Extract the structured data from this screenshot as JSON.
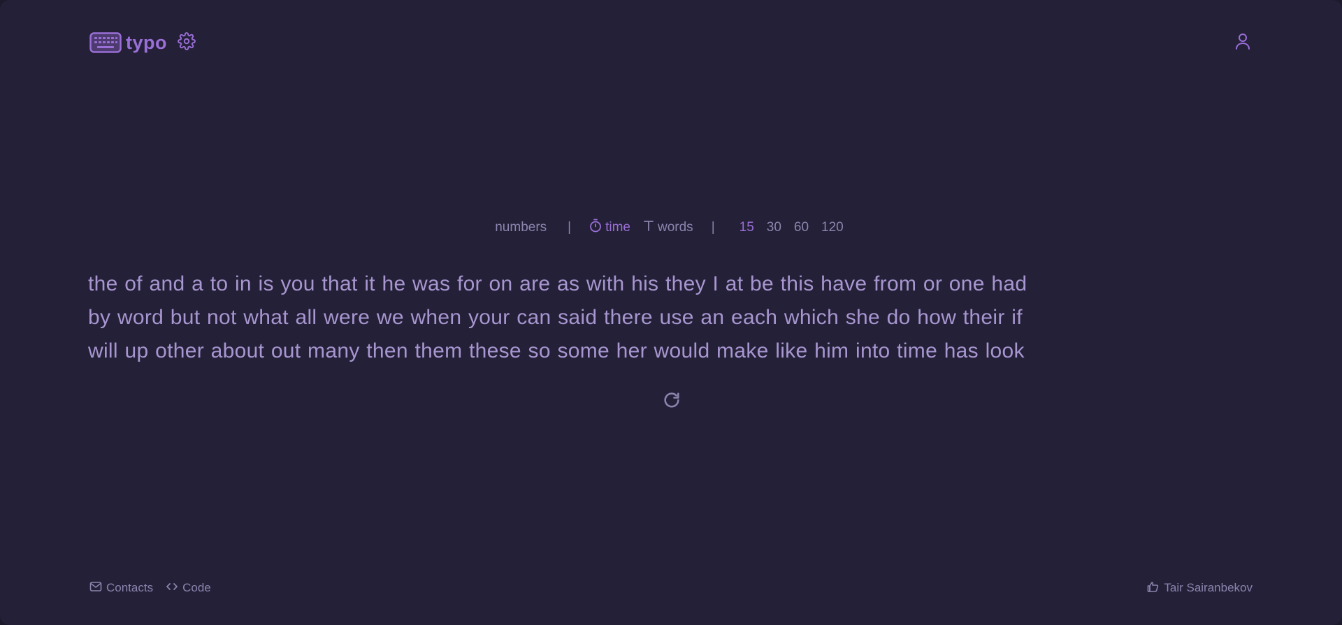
{
  "colors": {
    "background": "#242038",
    "accent": "#9a6fd6",
    "text_muted": "#8b84ad",
    "words": "#a796cf"
  },
  "header": {
    "logo_text": "typo",
    "logo_icon": "keyboard-icon",
    "settings_icon": "gear-icon",
    "user_icon": "user-icon"
  },
  "modebar": {
    "numbers_label": "numbers",
    "separator": "|",
    "time_label": "time",
    "time_icon": "stopwatch-icon",
    "words_label": "words",
    "words_icon": "text-t-icon",
    "durations": [
      "15",
      "30",
      "60",
      "120"
    ],
    "active_duration": "15",
    "active_mode": "time"
  },
  "test": {
    "lines": [
      "the of and a to in is you that it he was for on are as with his they I at be this have from or one had",
      "by word but not what all were we when your can said there use an each which she do how their if",
      "will up other about out many then them these so some her would make like him into time has look"
    ],
    "restart_icon": "restart-icon"
  },
  "footer": {
    "contacts_label": "Contacts",
    "contacts_icon": "mail-icon",
    "code_label": "Code",
    "code_icon": "code-icon",
    "author": "Tair Sairanbekov",
    "author_icon": "hand-icon"
  }
}
